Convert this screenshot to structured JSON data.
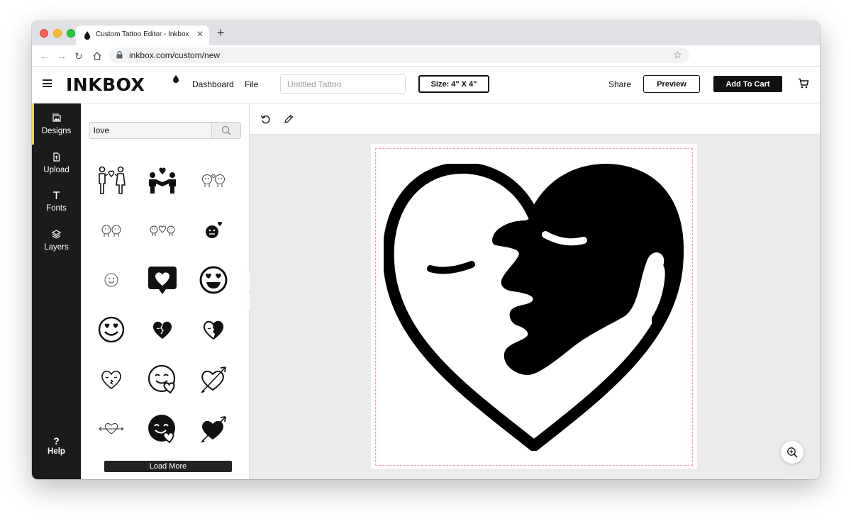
{
  "browser": {
    "tab_title": "Custom Tattoo Editor - Inkbox",
    "tab_close": "✕",
    "new_tab": "+",
    "url": "inkbox.com/custom/new",
    "icons": [
      "back-icon",
      "forward-icon",
      "reload-icon",
      "home-icon",
      "lock-icon",
      "star-icon"
    ]
  },
  "header": {
    "logo": "INKBOX",
    "nav": {
      "dashboard": "Dashboard",
      "file": "File"
    },
    "title_placeholder": "Untitled Tattoo",
    "size_label": "Size: 4\" X 4\"",
    "share_label": "Share",
    "preview_label": "Preview",
    "add_to_cart_label": "Add To Cart"
  },
  "sidebar": {
    "items": [
      {
        "label": "Designs",
        "icon": "image-icon",
        "active": true
      },
      {
        "label": "Upload",
        "icon": "upload-file-icon",
        "active": false
      },
      {
        "label": "Fonts",
        "icon": "text-icon",
        "active": false
      },
      {
        "label": "Layers",
        "icon": "layers-icon",
        "active": false
      }
    ],
    "help": {
      "icon": "?",
      "label": "Help"
    }
  },
  "designs_panel": {
    "search_value": "love",
    "results": [
      "couple-heart-icon",
      "couple-hands-heart-icon",
      "two-faces-icon",
      "two-faces-small-icon",
      "three-faces-icon",
      "face-heart-icon",
      "smiley-outline-icon",
      "heart-speech-bubble-icon",
      "heart-eyes-emoji-icon",
      "heart-eyes-smiley-icon",
      "broken-heart-face-icon",
      "heart-face-profile-icon",
      "heart-kiss-face-icon",
      "smiley-holding-heart-icon",
      "heart-arrow-icon",
      "heart-arrow-small-icon",
      "smiley-heart-filled-icon",
      "filled-heart-arrow-icon"
    ],
    "load_more_label": "Load More",
    "collapse_label": "‹"
  },
  "canvas": {
    "tools": [
      "undo-icon",
      "pencil-icon"
    ],
    "design": "heart-face-tattoo",
    "zoom_icon": "zoom-in-icon"
  },
  "colors": {
    "brand_black": "#111111",
    "rail_bg": "#1b1b1b",
    "active_accent": "#f2d24b",
    "canvas_bg": "#ebebeb",
    "safe_zone": "#f0a0aa"
  }
}
